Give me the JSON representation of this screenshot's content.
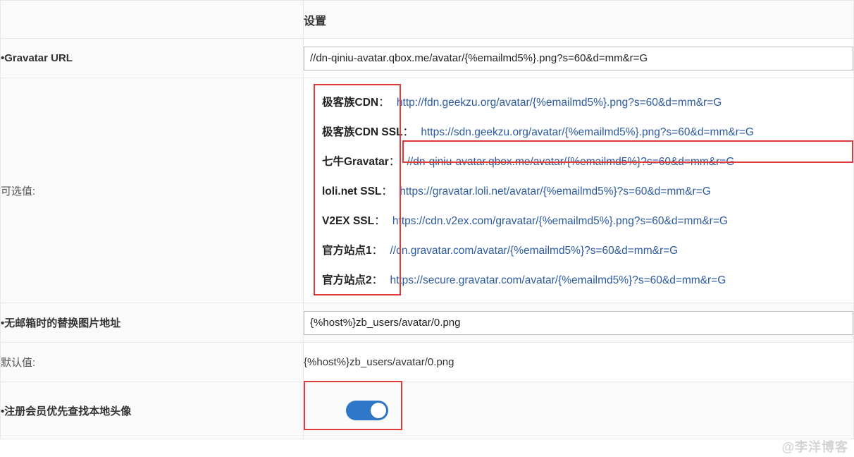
{
  "header": {
    "settings": "设置"
  },
  "rows": {
    "gravatar_url": {
      "label": "•Gravatar URL",
      "value": "//dn-qiniu-avatar.qbox.me/avatar/{%emailmd5%}.png?s=60&d=mm&r=G"
    },
    "optional": {
      "label": "可选值:",
      "items": [
        {
          "name": "极客族CDN",
          "url": "http://fdn.geekzu.org/avatar/{%emailmd5%}.png?s=60&d=mm&r=G"
        },
        {
          "name": "极客族CDN SSL",
          "url": "https://sdn.geekzu.org/avatar/{%emailmd5%}.png?s=60&d=mm&r=G"
        },
        {
          "name": "七牛Gravatar",
          "url": "//dn-qiniu-avatar.qbox.me/avatar/{%emailmd5%}?s=60&d=mm&r=G"
        },
        {
          "name": "loli.net SSL",
          "url": "https://gravatar.loli.net/avatar/{%emailmd5%}?s=60&d=mm&r=G"
        },
        {
          "name": "V2EX SSL",
          "url": "https://cdn.v2ex.com/gravatar/{%emailmd5%}.png?s=60&d=mm&r=G"
        },
        {
          "name": "官方站点1",
          "url": "//cn.gravatar.com/avatar/{%emailmd5%}?s=60&d=mm&r=G"
        },
        {
          "name": "官方站点2",
          "url": "https://secure.gravatar.com/avatar/{%emailmd5%}?s=60&d=mm&r=G"
        }
      ]
    },
    "fallback_url": {
      "label": "•无邮箱时的替换图片地址",
      "value": "{%host%}zb_users/avatar/0.png"
    },
    "default_value": {
      "label": "默认值:",
      "text": "{%host%}zb_users/avatar/0.png"
    },
    "local_avatar": {
      "label": "•注册会员优先查找本地头像",
      "on": true
    }
  },
  "watermark": "@李洋博客"
}
